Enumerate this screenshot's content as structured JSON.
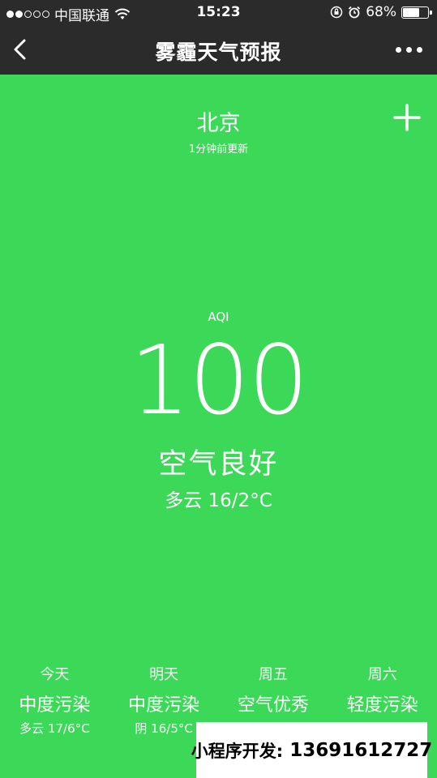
{
  "status_bar": {
    "carrier": "中国联通",
    "time": "15:23",
    "battery_percent": "68%",
    "battery_level": 0.68,
    "signal_bars": 2,
    "signal_total": 5
  },
  "nav": {
    "title": "雾霾天气预报",
    "back_icon": "chevron-left-icon",
    "more_icon": "more-dots-icon"
  },
  "location": {
    "city": "北京",
    "updated": "1分钟前更新",
    "add_icon": "plus-icon"
  },
  "aqi": {
    "label": "AQI",
    "value": "100",
    "quality": "空气良好",
    "weather": "多云 16/2°C"
  },
  "forecast": [
    {
      "day": "今天",
      "level": "中度污染",
      "weather": "多云 17/6°C"
    },
    {
      "day": "明天",
      "level": "中度污染",
      "weather": "阴 16/5°C"
    },
    {
      "day": "周五",
      "level": "空气优秀",
      "weather": ""
    },
    {
      "day": "周六",
      "level": "轻度污染",
      "weather": ""
    }
  ],
  "ad_banner": {
    "label": "小程序开发:",
    "phone": "13691612727"
  },
  "colors": {
    "background": "#3bd957",
    "bar": "#2b2b2b"
  }
}
